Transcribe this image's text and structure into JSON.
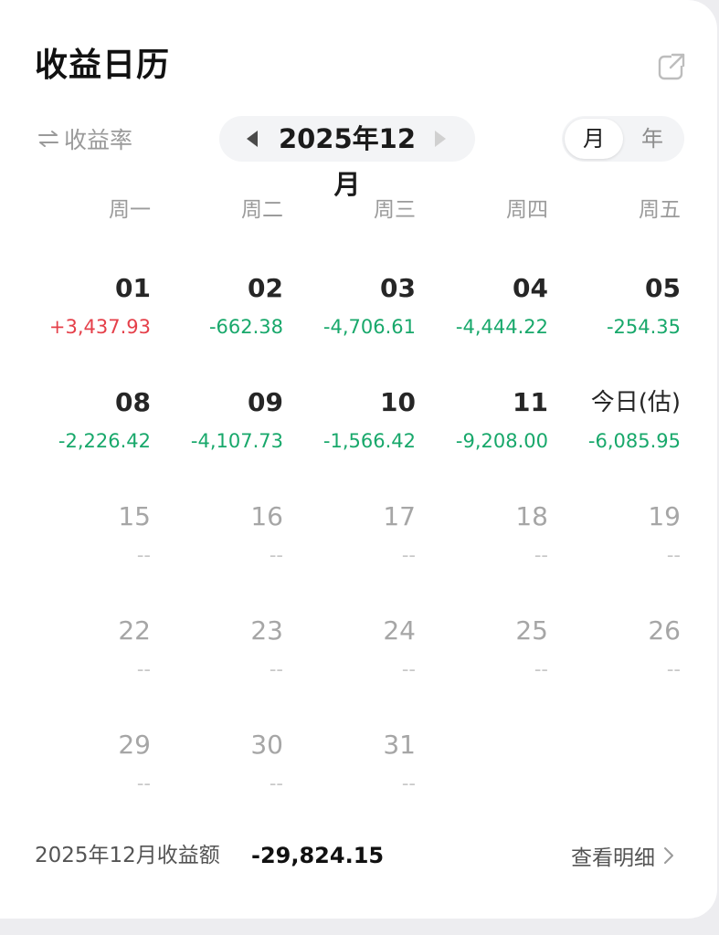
{
  "header": {
    "title": "收益日历",
    "share_icon": "external-share-icon"
  },
  "controls": {
    "rate_toggle_label": "收益率",
    "rate_toggle_icon": "swap-arrows-icon",
    "month_label": "2025年12月",
    "prev_icon": "triangle-left-icon",
    "next_icon": "triangle-right-icon",
    "period_options": [
      "月",
      "年"
    ],
    "period_selected": "月"
  },
  "weekdays": [
    "周一",
    "周二",
    "周三",
    "周四",
    "周五"
  ],
  "weeks": [
    [
      {
        "day": "01",
        "value": "+3,437.93",
        "status": "pos"
      },
      {
        "day": "02",
        "value": "-662.38",
        "status": "neg"
      },
      {
        "day": "03",
        "value": "-4,706.61",
        "status": "neg"
      },
      {
        "day": "04",
        "value": "-4,444.22",
        "status": "neg"
      },
      {
        "day": "05",
        "value": "-254.35",
        "status": "neg"
      }
    ],
    [
      {
        "day": "08",
        "value": "-2,226.42",
        "status": "neg"
      },
      {
        "day": "09",
        "value": "-4,107.73",
        "status": "neg"
      },
      {
        "day": "10",
        "value": "-1,566.42",
        "status": "neg"
      },
      {
        "day": "11",
        "value": "-9,208.00",
        "status": "neg"
      },
      {
        "day": "今日(估)",
        "value": "-6,085.95",
        "status": "neg",
        "today": true
      }
    ],
    [
      {
        "day": "15",
        "value": "--",
        "status": "none"
      },
      {
        "day": "16",
        "value": "--",
        "status": "none"
      },
      {
        "day": "17",
        "value": "--",
        "status": "none"
      },
      {
        "day": "18",
        "value": "--",
        "status": "none"
      },
      {
        "day": "19",
        "value": "--",
        "status": "none"
      }
    ],
    [
      {
        "day": "22",
        "value": "--",
        "status": "none"
      },
      {
        "day": "23",
        "value": "--",
        "status": "none"
      },
      {
        "day": "24",
        "value": "--",
        "status": "none"
      },
      {
        "day": "25",
        "value": "--",
        "status": "none"
      },
      {
        "day": "26",
        "value": "--",
        "status": "none"
      }
    ],
    [
      {
        "day": "29",
        "value": "--",
        "status": "none"
      },
      {
        "day": "30",
        "value": "--",
        "status": "none"
      },
      {
        "day": "31",
        "value": "--",
        "status": "none"
      }
    ]
  ],
  "footer": {
    "summary_label": "2025年12月收益额",
    "summary_total": "-29,824.15",
    "details_label": "查看明细",
    "details_icon": "chevron-right-icon"
  },
  "colors": {
    "positive": "#e5404a",
    "negative": "#18a86b",
    "empty": "#c8c8c8"
  }
}
